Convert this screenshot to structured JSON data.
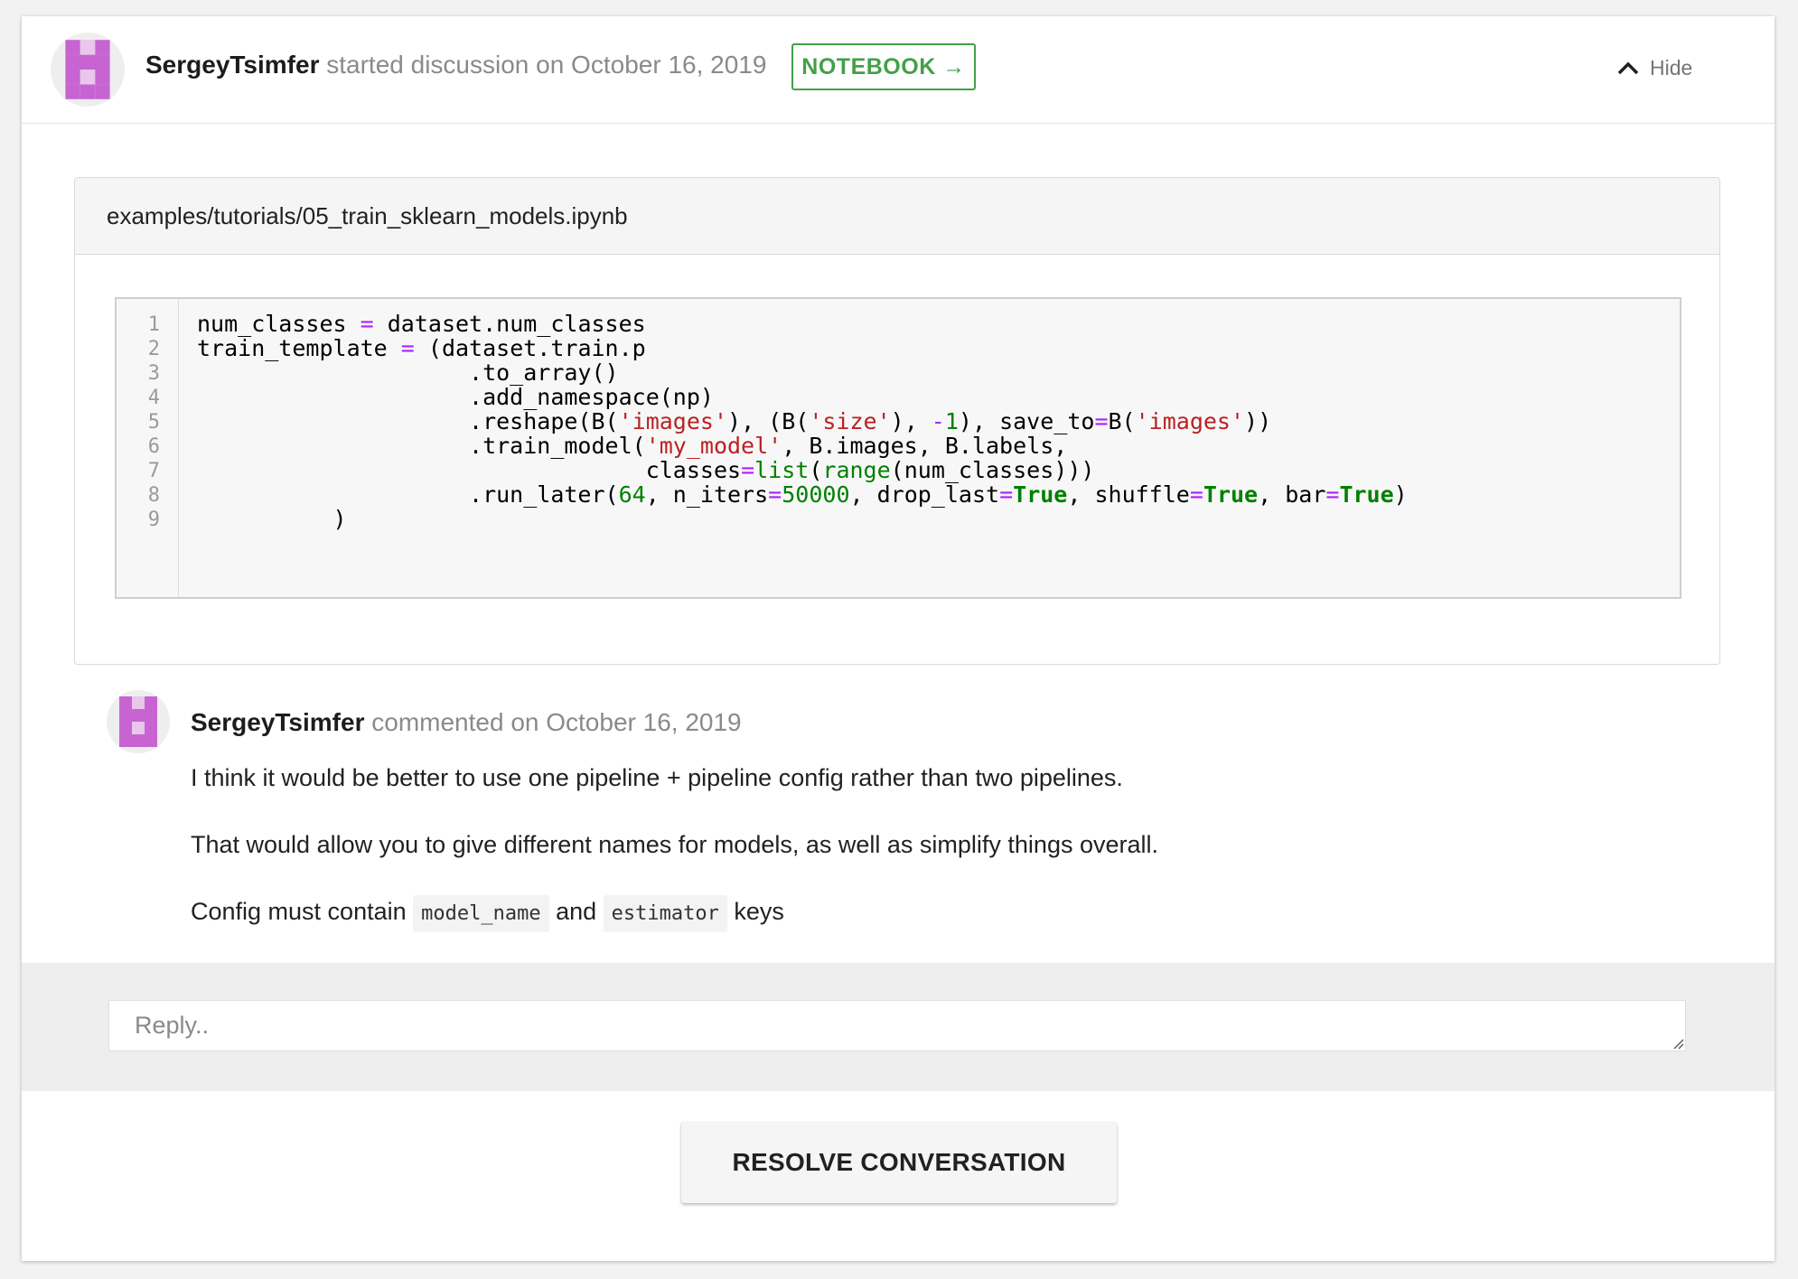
{
  "discussion": {
    "author": "SergeyTsimfer",
    "action_text": " started discussion on October 16, 2019",
    "notebook_button": "NOTEBOOK →",
    "hide_label": "Hide"
  },
  "notebook": {
    "path": "examples/tutorials/05_train_sklearn_models.ipynb",
    "line_numbers": [
      "1",
      "2",
      "3",
      "4",
      "5",
      "6",
      "7",
      "8",
      "9"
    ],
    "code_lines": [
      "num_classes = dataset.num_classes",
      "train_template = (dataset.train.p",
      "                    .to_array()",
      "                    .add_namespace(np)",
      "                    .reshape(B('images'), (B('size'), -1), save_to=B('images'))",
      "                    .train_model('my_model', B.images, B.labels,",
      "                                 classes=list(range(num_classes)))",
      "                    .run_later(64, n_iters=50000, drop_last=True, shuffle=True, bar=True)",
      "          )"
    ]
  },
  "comment": {
    "author": "SergeyTsimfer",
    "meta": " commented on October 16, 2019",
    "paragraph1": "I think it would be better to use one pipeline + pipeline config rather than two pipelines.",
    "paragraph2": "That would allow you to give different names for models, as well as simplify things overall.",
    "p3_prefix": "Config must contain ",
    "p3_code1": "model_name",
    "p3_mid": " and ",
    "p3_code2": "estimator",
    "p3_suffix": " keys"
  },
  "reply": {
    "placeholder": "Reply.."
  },
  "resolve_button": "RESOLVE CONVERSATION",
  "colors": {
    "accent_green": "#43a047",
    "avatar_purple": "#c864d2",
    "code_operator": "#aa22ff",
    "code_string": "#ba2121",
    "code_number": "#008000"
  },
  "icons": {
    "avatar": "identicon-avatar",
    "hide": "chevron-up-icon",
    "resize": "resize-grip-icon"
  }
}
